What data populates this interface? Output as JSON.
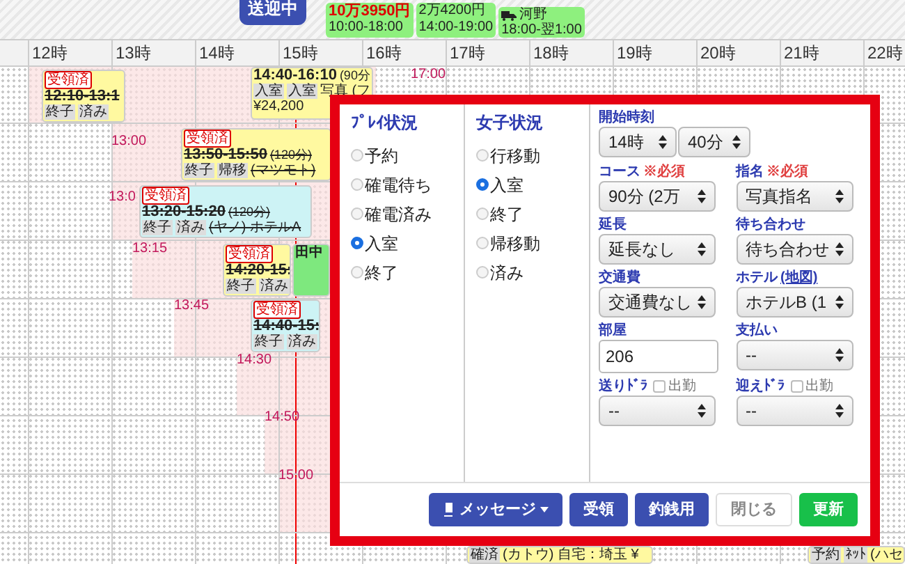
{
  "topbar": {
    "status_button": "送迎中",
    "drivers": [
      {
        "amount": "10万3950円",
        "hours": "10:00-18:00"
      },
      {
        "amount": "2万4200円",
        "hours": "14:00-19:00"
      },
      {
        "name": "河野",
        "hours": "18:00-翌1:00"
      }
    ]
  },
  "hours": [
    "12時",
    "13時",
    "14時",
    "15時",
    "16時",
    "17時",
    "18時",
    "19時",
    "20時",
    "21時",
    "22時"
  ],
  "time_marks": [
    {
      "text": "13:00"
    },
    {
      "text": "13:0"
    },
    {
      "text": "13:15"
    },
    {
      "text": "13:45"
    },
    {
      "text": "14:30"
    },
    {
      "text": "14:50"
    },
    {
      "text": "15:00"
    },
    {
      "text": "17:00"
    }
  ],
  "bookings": [
    {
      "color": "#fff9a0",
      "badge": "受領済",
      "time": "12:10-13:1",
      "struck": true,
      "tags": [
        "終子",
        "済み"
      ]
    },
    {
      "color": "#fff9a0",
      "time": "14:40-16:10",
      "note": "(90分",
      "struck": false,
      "tags": [
        "入室",
        "入室"
      ],
      "detail": "写真 (フ",
      "price": "¥24,200"
    },
    {
      "color": "#fff9a0",
      "badge": "受領済",
      "time": "13:50-15:50",
      "note": "(120分)",
      "struck": true,
      "tags": [
        "終子",
        "帰移"
      ],
      "detail": "(マツモト)"
    },
    {
      "color": "#cdf3f5",
      "badge": "受領済",
      "time": "13:20-15:20",
      "note": "(120分)",
      "struck": true,
      "tags": [
        "終子",
        "済み"
      ],
      "detail": "(ヤノ) ホテルA"
    },
    {
      "color": "#fff9a0",
      "badge": "受領済",
      "time": "14:20-15:",
      "struck": true,
      "tags": [
        "終子",
        "済み"
      ]
    },
    {
      "color": "#7ee87e",
      "time": "田中",
      "struck": false
    },
    {
      "color": "#cdf3f5",
      "badge": "受領済",
      "time": "14:40-15:",
      "struck": true,
      "tags": [
        "終子",
        "済み"
      ]
    },
    {
      "color": "#fff9a0",
      "tags": [
        "確済"
      ],
      "detail": "(カトウ) 自宅：埼玉 ¥"
    },
    {
      "color": "#fff9a0",
      "tags": [
        "予約",
        "ﾈｯﾄ"
      ],
      "detail": "(ハセ"
    }
  ],
  "dialog": {
    "play_status": {
      "title": "ﾌﾟﾚｲ状況",
      "options": [
        {
          "label": "予約",
          "selected": false
        },
        {
          "label": "確電待ち",
          "selected": false
        },
        {
          "label": "確電済み",
          "selected": false
        },
        {
          "label": "入室",
          "selected": true
        },
        {
          "label": "終了",
          "selected": false
        }
      ]
    },
    "girl_status": {
      "title": "女子状況",
      "options": [
        {
          "label": "行移動",
          "selected": false
        },
        {
          "label": "入室",
          "selected": true
        },
        {
          "label": "終了",
          "selected": false
        },
        {
          "label": "帰移動",
          "selected": false
        },
        {
          "label": "済み",
          "selected": false
        }
      ]
    },
    "start_time": {
      "label": "開始時刻",
      "hour": "14時",
      "minute": "40分"
    },
    "fields": [
      {
        "label": "コース",
        "required": "※必須",
        "kind": "select",
        "value": "90分 (2万"
      },
      {
        "label": "指名",
        "required": "※必須",
        "kind": "select",
        "value": "写真指名"
      },
      {
        "label": "延長",
        "kind": "select",
        "value": "延長なし"
      },
      {
        "label": "待ち合わせ",
        "kind": "select",
        "value": "待ち合わせ"
      },
      {
        "label": "交通費",
        "kind": "select",
        "value": "交通費なし"
      },
      {
        "label": "ホテル",
        "link": "(地図)",
        "kind": "select",
        "value": "ホテルB (1"
      },
      {
        "label": "部屋",
        "kind": "input",
        "value": "206"
      },
      {
        "label": "支払い",
        "kind": "select",
        "value": "--"
      },
      {
        "label": "送りﾄﾞﾗ",
        "kind": "select",
        "value": "--",
        "checkbox": {
          "label": "出勤",
          "checked": false
        }
      },
      {
        "label": "迎えﾄﾞﾗ",
        "kind": "select",
        "value": "--",
        "checkbox": {
          "label": "出勤",
          "checked": false
        }
      }
    ],
    "buttons": [
      {
        "label": "メッセージ",
        "kind": "menu"
      },
      {
        "label": "受領",
        "kind": "primary"
      },
      {
        "label": "釣銭用",
        "kind": "primary"
      },
      {
        "label": "閉じる",
        "kind": "plain"
      },
      {
        "label": "更新",
        "kind": "success"
      }
    ]
  }
}
